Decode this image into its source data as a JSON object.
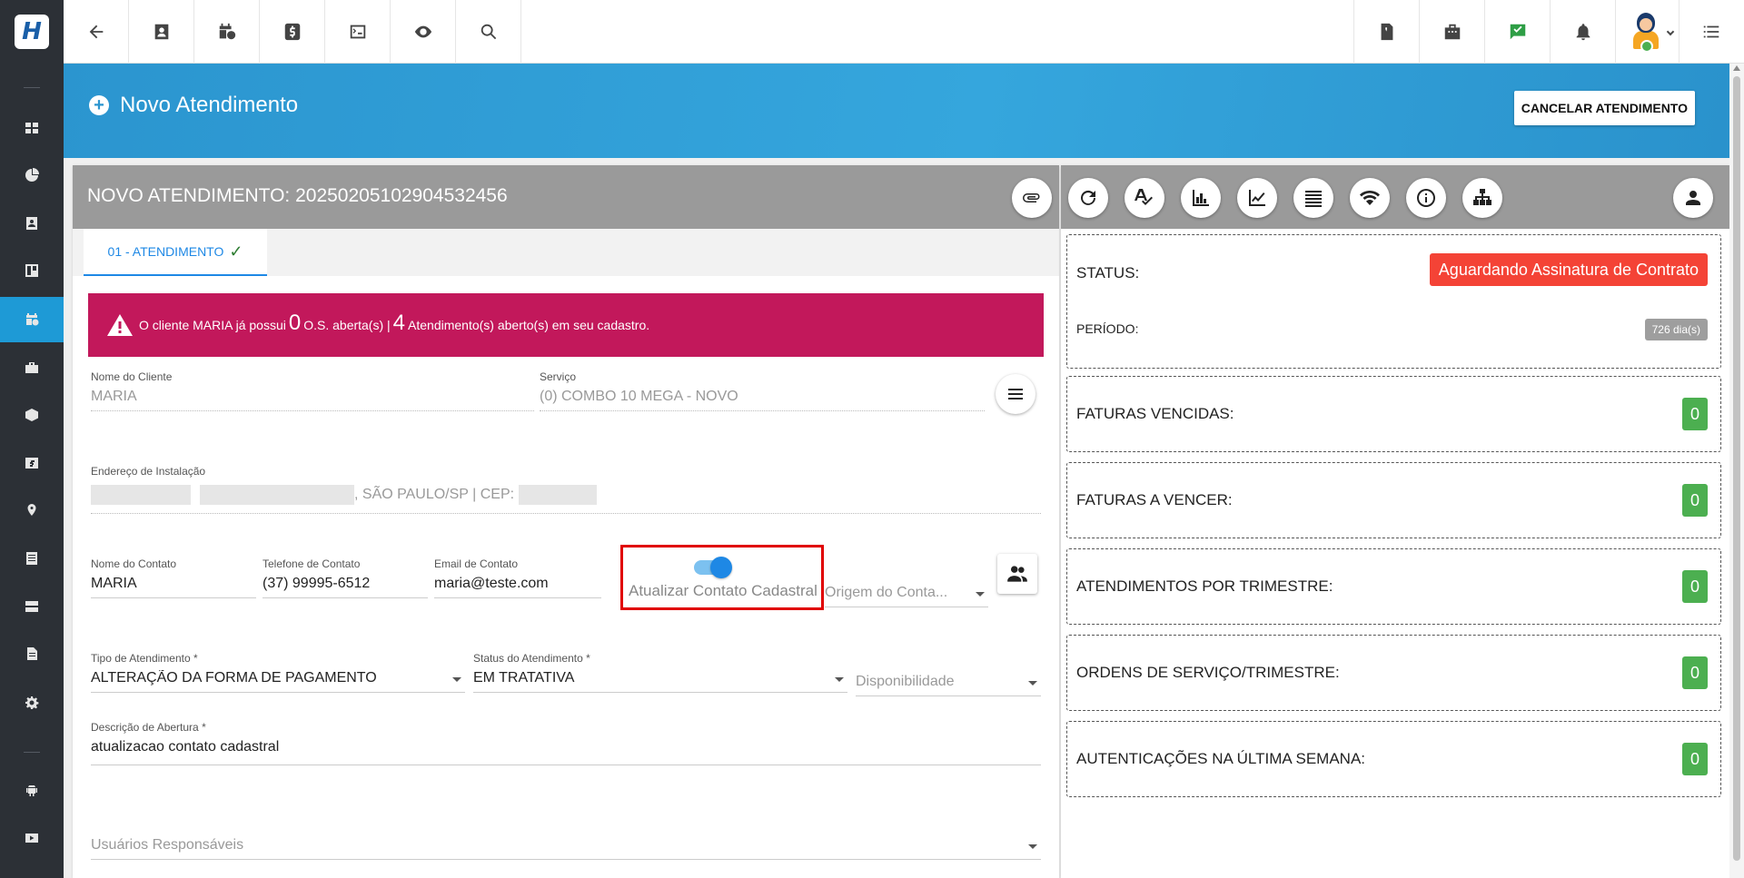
{
  "app": {
    "logo_text": "H"
  },
  "sidebar": {
    "items": [
      "dashboard-icon",
      "chart-pie-icon",
      "contact-card-icon",
      "board-icon",
      "calendar-clock-icon",
      "briefcase-icon",
      "box-icon",
      "money-icon",
      "location-icon",
      "list-icon",
      "server-icon",
      "document-icon",
      "gear-icon",
      "android-icon",
      "youtube-icon"
    ],
    "active": "calendar-clock-icon"
  },
  "hero": {
    "title": "Novo Atendimento",
    "cancel_label": "CANCELAR ATENDIMENTO"
  },
  "card": {
    "title": "NOVO ATENDIMENTO: 20250205102904532456",
    "tab_label": "01 - ATENDIMENTO"
  },
  "alert": {
    "pre": "O cliente MARIA já possui",
    "os_count": "0",
    "mid": "O.S. aberta(s) |",
    "atend_count": "4",
    "post": "Atendimento(s) aberto(s) em seu cadastro."
  },
  "form": {
    "cliente": {
      "label": "Nome do Cliente",
      "value": "MARIA"
    },
    "servico": {
      "label": "Serviço",
      "value": "(0) COMBO 10 MEGA - NOVO"
    },
    "endereco": {
      "label": "Endereço de Instalação",
      "value_mid": ", SÃO PAULO/SP | CEP:"
    },
    "contato": {
      "label": "Nome do Contato",
      "value": "MARIA"
    },
    "telefone": {
      "label": "Telefone de Contato",
      "value": "(37) 99995-6512"
    },
    "email": {
      "label": "Email de Contato",
      "value": "maria@teste.com"
    },
    "toggle": {
      "label": "Atualizar Contato Cadastral",
      "checked": true
    },
    "origem": {
      "placeholder": "Origem do Conta..."
    },
    "tipo": {
      "label": "Tipo de Atendimento *",
      "value": "ALTERAÇÃO DA FORMA DE PAGAMENTO"
    },
    "status": {
      "label": "Status do Atendimento *",
      "value": "EM TRATATIVA"
    },
    "disponibilidade": {
      "placeholder": "Disponibilidade"
    },
    "descricao": {
      "label": "Descrição de Abertura *",
      "value": "atualizacao contato cadastral"
    },
    "usuarios": {
      "placeholder": "Usuários Responsáveis"
    }
  },
  "panel": {
    "status_label": "STATUS:",
    "status_value": "Aguardando Assinatura de Contrato",
    "periodo_label": "PERÍODO:",
    "periodo_value": "726 dia(s)",
    "metrics": [
      {
        "label": "FATURAS VENCIDAS:",
        "value": "0"
      },
      {
        "label": "FATURAS A VENCER:",
        "value": "0"
      },
      {
        "label": "ATENDIMENTOS POR TRIMESTRE:",
        "value": "0"
      },
      {
        "label": "ORDENS DE SERVIÇO/TRIMESTRE:",
        "value": "0"
      },
      {
        "label": "AUTENTICAÇÕES NA ÚLTIMA SEMANA:",
        "value": "0"
      }
    ]
  },
  "colors": {
    "accent": "#1e9ad6",
    "alert": "#c2185b",
    "status": "#f44336",
    "ok": "#4caf50",
    "highlight": "#e00000"
  }
}
